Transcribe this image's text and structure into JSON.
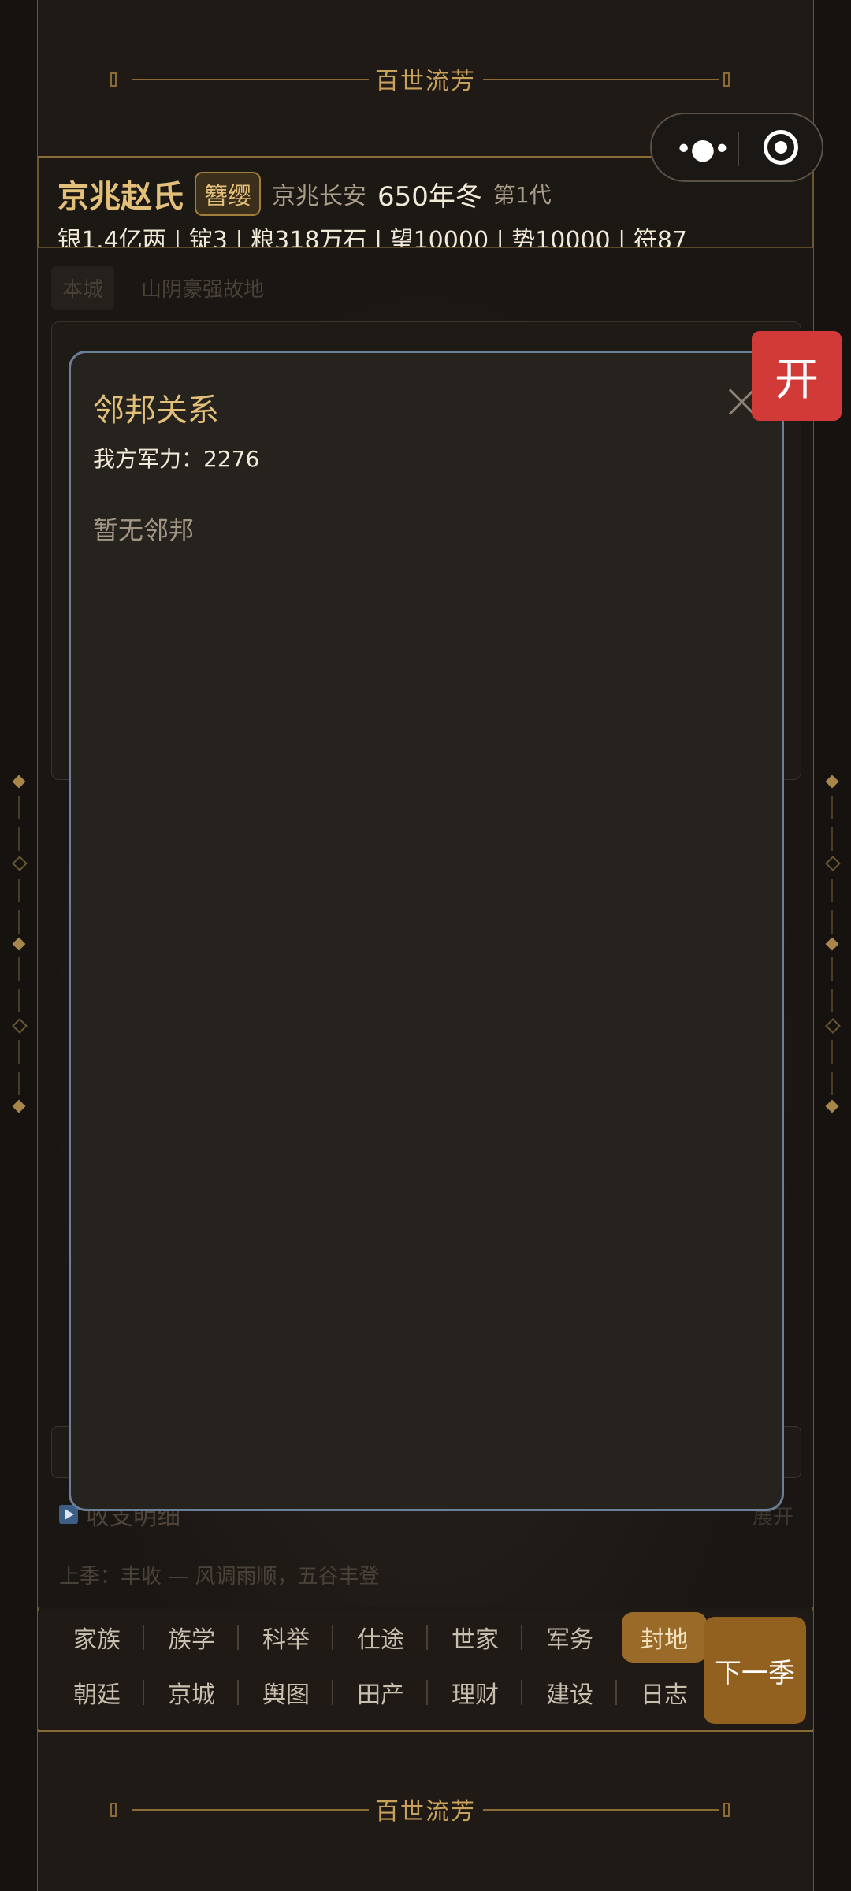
{
  "banner": {
    "title": "百世流芳"
  },
  "family": {
    "name": "京兆赵氏",
    "rank": "簪缨",
    "place": "京兆长安",
    "season": "650年冬",
    "generation": "第1代"
  },
  "resources": "银1.4亿两 | 锭3 | 粮318万石 | 望10000 | 势10000 | 符87",
  "background": {
    "tabs": [
      "本城",
      "山阴豪强故地"
    ],
    "income_label": "收支明细",
    "expand_label": "展开",
    "last_season": "上季：丰收 — 风调雨顺，五谷丰登"
  },
  "modal": {
    "title": "邻邦关系",
    "power_label": "我方军力：",
    "power_value": "2276",
    "empty_text": "暂无邻邦"
  },
  "open_button": "开",
  "nav": {
    "row1": [
      "家族",
      "族学",
      "科举",
      "仕途",
      "世家",
      "军务",
      "封地"
    ],
    "row2": [
      "朝廷",
      "京城",
      "舆图",
      "田产",
      "理财",
      "建设",
      "日志"
    ],
    "active": "封地",
    "next_button": "下一季"
  },
  "colors": {
    "gold": "#c8a25a",
    "active_tab": "#9a6a28",
    "next_button": "#93611f",
    "open_button": "#d23a38",
    "modal_border": "#6b7f99"
  }
}
